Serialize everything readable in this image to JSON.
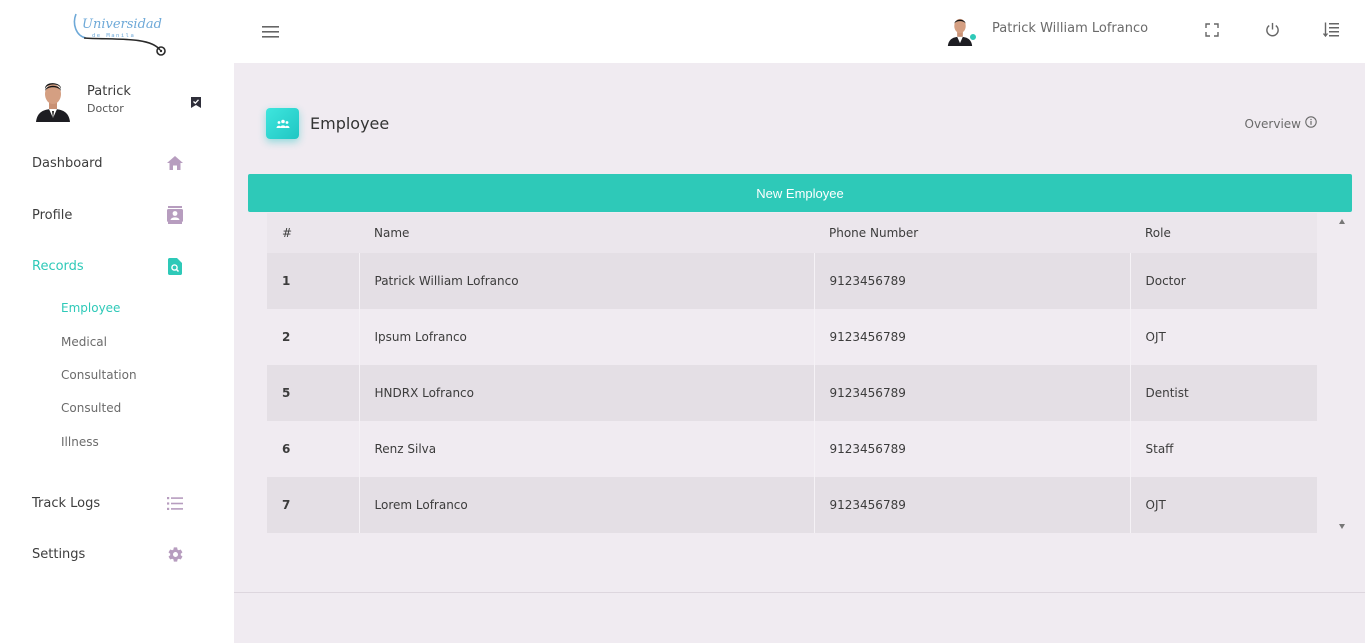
{
  "brand": {
    "logo_line1": "Universidad",
    "logo_line2": "de Manila"
  },
  "sidebar": {
    "user": {
      "name": "Patrick",
      "role": "Doctor"
    },
    "nav": [
      {
        "label": "Dashboard",
        "icon": "home-icon"
      },
      {
        "label": "Profile",
        "icon": "contact-card-icon"
      },
      {
        "label": "Records",
        "icon": "search-document-icon",
        "active": true
      },
      {
        "label": "Track Logs",
        "icon": "list-icon"
      },
      {
        "label": "Settings",
        "icon": "gear-icon"
      }
    ],
    "records_sub": [
      {
        "label": "Employee",
        "active": true
      },
      {
        "label": "Medical"
      },
      {
        "label": "Consultation"
      },
      {
        "label": "Consulted"
      },
      {
        "label": "Illness"
      }
    ]
  },
  "topbar": {
    "user_full_name": "Patrick William Lofranco",
    "icons": [
      "menu-icon",
      "fullscreen-icon",
      "power-icon",
      "sort-list-icon"
    ]
  },
  "page": {
    "title": "Employee",
    "overview_label": "Overview",
    "new_button_label": "New Employee"
  },
  "table": {
    "columns": [
      "#",
      "Name",
      "Phone Number",
      "Role"
    ],
    "rows": [
      {
        "id": "1",
        "name": "Patrick William Lofranco",
        "phone": "9123456789",
        "role": "Doctor"
      },
      {
        "id": "2",
        "name": "Ipsum Lofranco",
        "phone": "9123456789",
        "role": "OJT"
      },
      {
        "id": "5",
        "name": "HNDRX Lofranco",
        "phone": "9123456789",
        "role": "Dentist"
      },
      {
        "id": "6",
        "name": "Renz Silva",
        "phone": "9123456789",
        "role": "Staff"
      },
      {
        "id": "7",
        "name": "Lorem Lofranco",
        "phone": "9123456789",
        "role": "OJT"
      }
    ]
  },
  "colors": {
    "accent": "#2ec9b8",
    "main_bg": "#f0ebf1",
    "row_odd": "#e4dfe5",
    "icon_muted": "#b79dbf"
  }
}
